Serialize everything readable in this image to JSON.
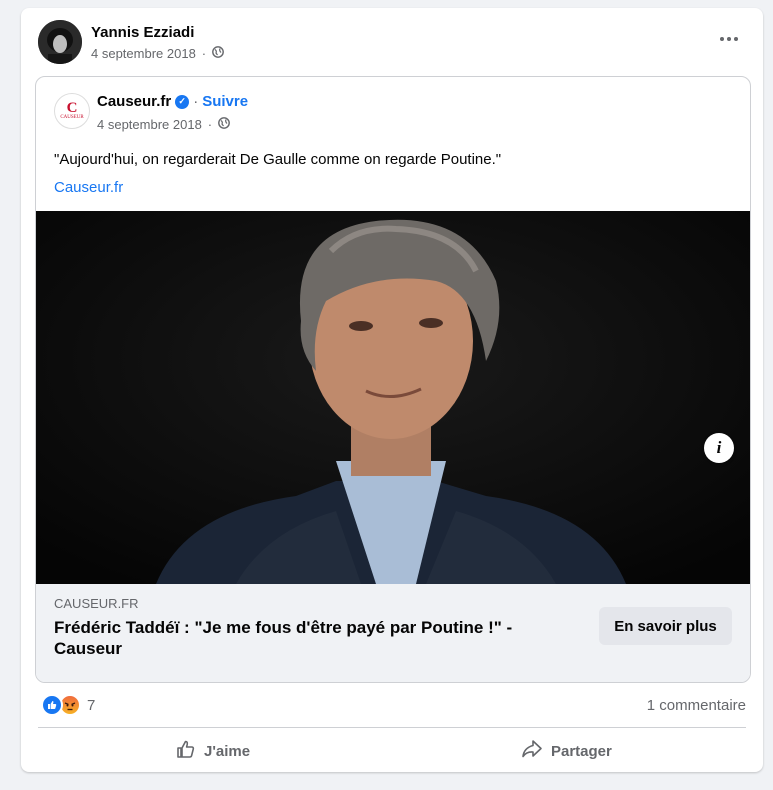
{
  "post": {
    "author": "Yannis Ezziadi",
    "date": "4 septembre 2018",
    "separator": "·"
  },
  "shared": {
    "page_name": "Causeur.fr",
    "avatar_letter": "C",
    "avatar_word": "CAUSEUR",
    "separator": "·",
    "follow": "Suivre",
    "date": "4 septembre 2018",
    "quote": "\"Aujourd'hui, on regarderait De Gaulle comme on regarde Poutine.\"",
    "link_text": "Causeur.fr",
    "info_label": "i"
  },
  "link_preview": {
    "domain": "CAUSEUR.FR",
    "headline": "Frédéric Taddéï : \"Je me fous d'être payé par Poutine !\" - Causeur",
    "cta": "En savoir plus"
  },
  "engagement": {
    "reaction_count": "7",
    "comments": "1 commentaire",
    "like_label": "J'aime",
    "share_label": "Partager"
  },
  "colors": {
    "accent": "#1877f2",
    "brand_red": "#c8102e",
    "muted": "#65676b"
  }
}
